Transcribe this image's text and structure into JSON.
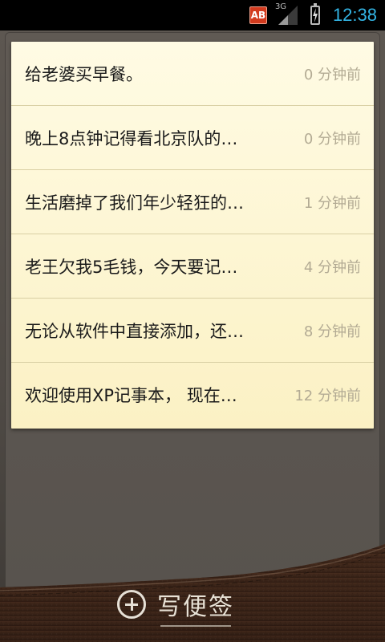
{
  "status_bar": {
    "badge": "AB",
    "network": "3G",
    "time": "12:38"
  },
  "notes": [
    {
      "text": "给老婆买早餐。",
      "time": "0 分钟前"
    },
    {
      "text": "晚上8点钟记得看北京队的…",
      "time": "0 分钟前"
    },
    {
      "text": "生活磨掉了我们年少轻狂的…",
      "time": "1 分钟前"
    },
    {
      "text": "老王欠我5毛钱，今天要记…",
      "time": "4 分钟前"
    },
    {
      "text": "无论从软件中直接添加，还…",
      "time": "8 分钟前"
    },
    {
      "text": "欢迎使用XP记事本， 现在…",
      "time": "12 分钟前"
    }
  ],
  "footer": {
    "add_note_label": "写便签"
  },
  "colors": {
    "clock": "#33b5e5",
    "note_paper": "#fbf1c4",
    "leather": "#3a2418"
  }
}
